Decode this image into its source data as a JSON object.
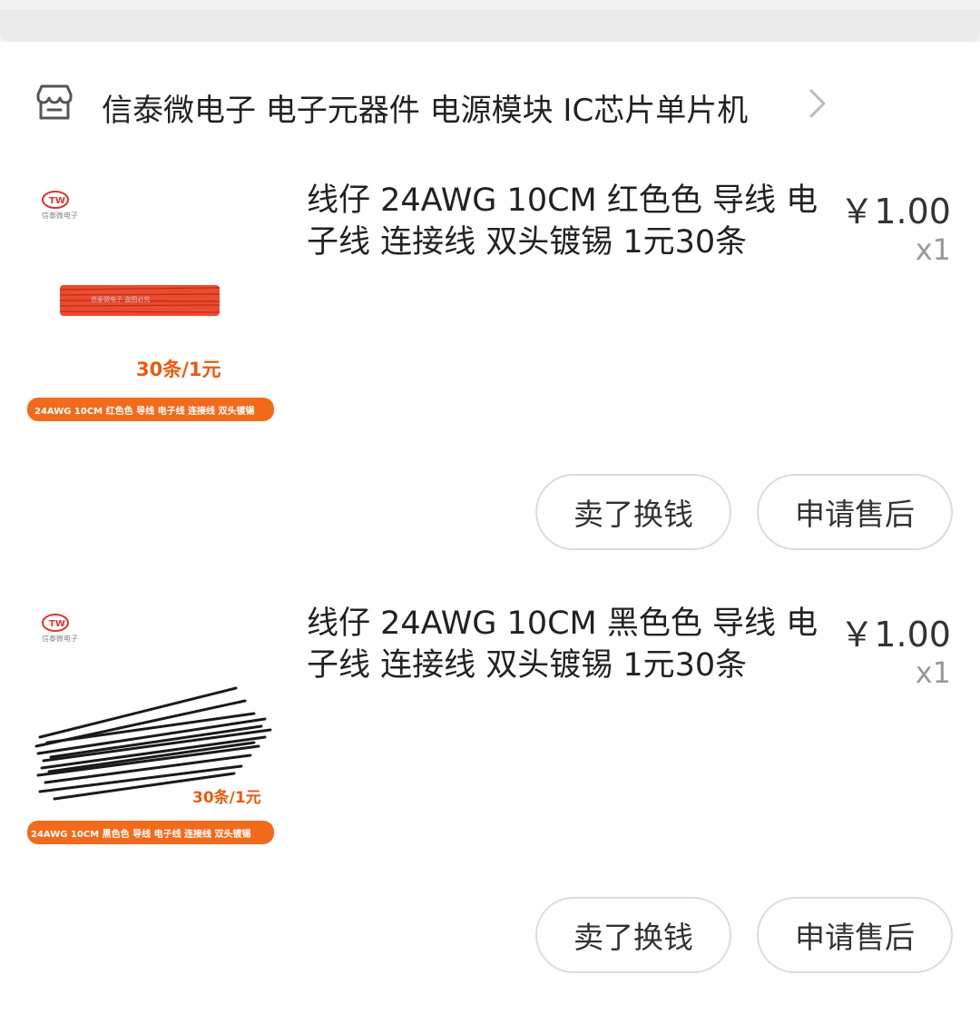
{
  "shop": {
    "name": "信泰微电子 电子元器件 电源模块 IC芯片单片机",
    "icon": "store-icon"
  },
  "items": [
    {
      "title": "线仔 24AWG 10CM 红色色 导线 电子线 连接线 双头镀锡 1元30条",
      "price": "￥1.00",
      "qty": "x1",
      "thumb": {
        "logo_text": "信泰微电子",
        "badge": "30条/1元",
        "banner": "24AWG 10CM 红色色 导线 电子线 连接线 双头镀锡",
        "wire_color": "#e8391d"
      },
      "buttons": {
        "sell": "卖了换钱",
        "after_sale": "申请售后"
      }
    },
    {
      "title": "线仔 24AWG 10CM 黑色色 导线 电子线 连接线 双头镀锡 1元30条",
      "price": "￥1.00",
      "qty": "x1",
      "thumb": {
        "logo_text": "信泰微电子",
        "badge": "30条/1元",
        "banner": "24AWG 10CM 黑色色 导线 电子线 连接线 双头镀锡",
        "wire_color": "#1a1a1a"
      },
      "buttons": {
        "sell": "卖了换钱",
        "after_sale": "申请售后"
      }
    }
  ],
  "colors": {
    "accent_orange": "#f26a1b",
    "badge_orange": "#e85b10",
    "divider": "#dcdcdc"
  }
}
